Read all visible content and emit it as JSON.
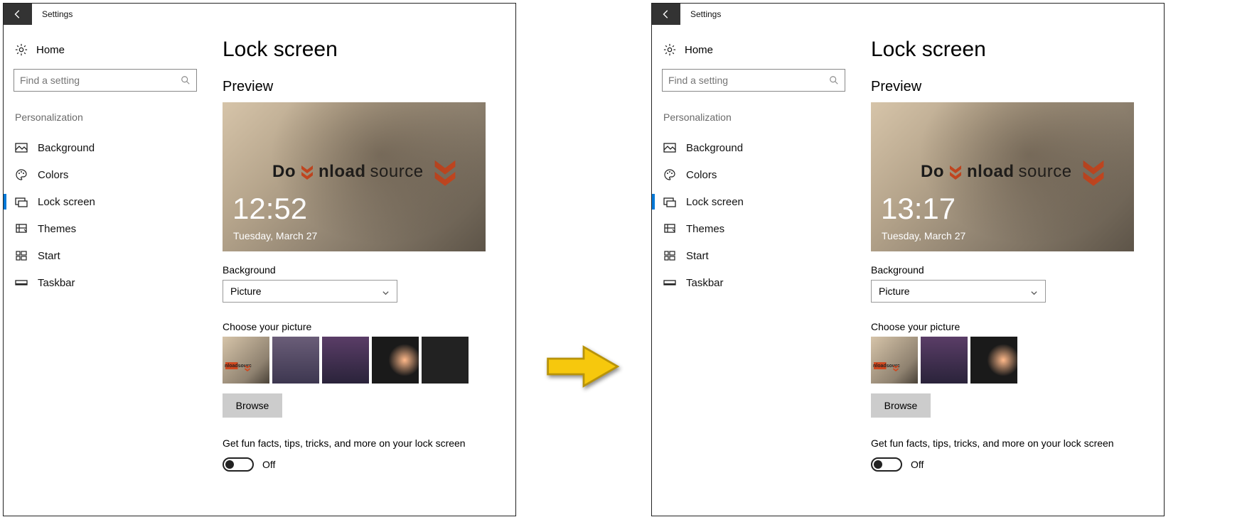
{
  "left": {
    "titlebar": "Settings",
    "home": "Home",
    "search_placeholder": "Find a setting",
    "section": "Personalization",
    "nav": [
      {
        "label": "Background"
      },
      {
        "label": "Colors"
      },
      {
        "label": "Lock screen",
        "active": true
      },
      {
        "label": "Themes"
      },
      {
        "label": "Start"
      },
      {
        "label": "Taskbar"
      }
    ],
    "page_title": "Lock screen",
    "preview_heading": "Preview",
    "preview_time": "12:52",
    "preview_date": "Tuesday, March 27",
    "preview_brand_a": "Do",
    "preview_brand_b": "nload",
    "preview_brand_c": "source",
    "bg_label": "Background",
    "bg_value": "Picture",
    "choose_label": "Choose your picture",
    "thumb_count": 5,
    "browse": "Browse",
    "fun_facts": "Get fun facts, tips, tricks, and more on your lock screen",
    "toggle_state": "Off"
  },
  "right": {
    "titlebar": "Settings",
    "home": "Home",
    "search_placeholder": "Find a setting",
    "section": "Personalization",
    "nav": [
      {
        "label": "Background"
      },
      {
        "label": "Colors"
      },
      {
        "label": "Lock screen",
        "active": true
      },
      {
        "label": "Themes"
      },
      {
        "label": "Start"
      },
      {
        "label": "Taskbar"
      }
    ],
    "page_title": "Lock screen",
    "preview_heading": "Preview",
    "preview_time": "13:17",
    "preview_date": "Tuesday, March 27",
    "preview_brand_a": "Do",
    "preview_brand_b": "nload",
    "preview_brand_c": "source",
    "bg_label": "Background",
    "bg_value": "Picture",
    "choose_label": "Choose your picture",
    "thumb_count": 3,
    "browse": "Browse",
    "fun_facts": "Get fun facts, tips, tricks, and more on your lock screen",
    "toggle_state": "Off"
  }
}
